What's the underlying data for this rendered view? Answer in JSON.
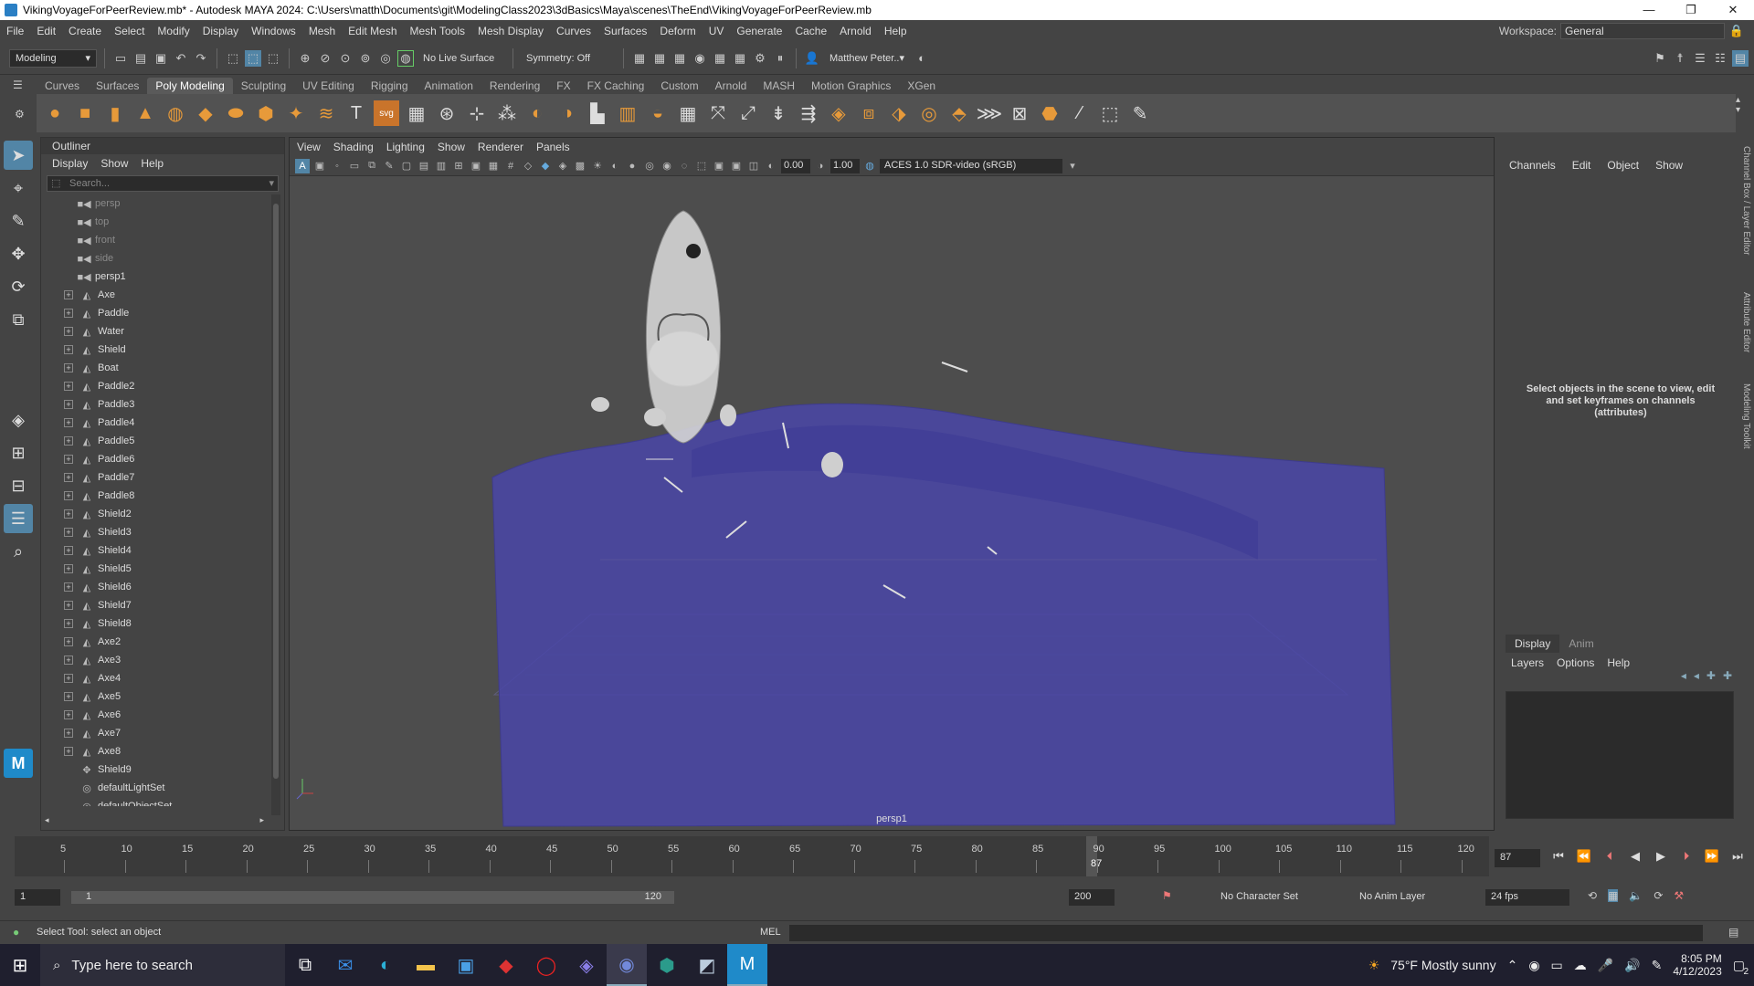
{
  "window": {
    "title": "VikingVoyageForPeerReview.mb* - Autodesk MAYA 2024: C:\\Users\\matth\\Documents\\git\\ModelingClass2023\\3dBasics\\Maya\\scenes\\TheEnd\\VikingVoyageForPeerReview.mb",
    "minimize": "—",
    "maximize": "❐",
    "close": "✕"
  },
  "menubar": {
    "items": [
      "File",
      "Edit",
      "Create",
      "Select",
      "Modify",
      "Display",
      "Windows",
      "Mesh",
      "Edit Mesh",
      "Mesh Tools",
      "Mesh Display",
      "Curves",
      "Surfaces",
      "Deform",
      "UV",
      "Generate",
      "Cache",
      "Arnold",
      "Help"
    ],
    "workspace_label": "Workspace:",
    "workspace_value": "General"
  },
  "statusline": {
    "mode": "Modeling",
    "live_surface": "No Live Surface",
    "symmetry": "Symmetry: Off",
    "user": "Matthew Peter.."
  },
  "shelf": {
    "tabs": [
      "Curves",
      "Surfaces",
      "Poly Modeling",
      "Sculpting",
      "UV Editing",
      "Rigging",
      "Animation",
      "Rendering",
      "FX",
      "FX Caching",
      "Custom",
      "Arnold",
      "MASH",
      "Motion Graphics",
      "XGen"
    ],
    "active_tab": "Poly Modeling"
  },
  "outliner": {
    "title": "Outliner",
    "menu": [
      "Display",
      "Show",
      "Help"
    ],
    "search_placeholder": "Search...",
    "items": [
      {
        "label": "persp",
        "type": "camera",
        "dim": true
      },
      {
        "label": "top",
        "type": "camera",
        "dim": true
      },
      {
        "label": "front",
        "type": "camera",
        "dim": true
      },
      {
        "label": "side",
        "type": "camera",
        "dim": true
      },
      {
        "label": "persp1",
        "type": "camera",
        "dim": false
      },
      {
        "label": "Axe",
        "type": "mesh"
      },
      {
        "label": "Paddle",
        "type": "mesh"
      },
      {
        "label": "Water",
        "type": "mesh"
      },
      {
        "label": "Shield",
        "type": "mesh"
      },
      {
        "label": "Boat",
        "type": "mesh"
      },
      {
        "label": "Paddle2",
        "type": "mesh"
      },
      {
        "label": "Paddle3",
        "type": "mesh"
      },
      {
        "label": "Paddle4",
        "type": "mesh"
      },
      {
        "label": "Paddle5",
        "type": "mesh"
      },
      {
        "label": "Paddle6",
        "type": "mesh"
      },
      {
        "label": "Paddle7",
        "type": "mesh"
      },
      {
        "label": "Paddle8",
        "type": "mesh"
      },
      {
        "label": "Shield2",
        "type": "mesh"
      },
      {
        "label": "Shield3",
        "type": "mesh"
      },
      {
        "label": "Shield4",
        "type": "mesh"
      },
      {
        "label": "Shield5",
        "type": "mesh"
      },
      {
        "label": "Shield6",
        "type": "mesh"
      },
      {
        "label": "Shield7",
        "type": "mesh"
      },
      {
        "label": "Shield8",
        "type": "mesh"
      },
      {
        "label": "Axe2",
        "type": "mesh"
      },
      {
        "label": "Axe3",
        "type": "mesh"
      },
      {
        "label": "Axe4",
        "type": "mesh"
      },
      {
        "label": "Axe5",
        "type": "mesh"
      },
      {
        "label": "Axe6",
        "type": "mesh"
      },
      {
        "label": "Axe7",
        "type": "mesh"
      },
      {
        "label": "Axe8",
        "type": "mesh"
      },
      {
        "label": "Shield9",
        "type": "group"
      },
      {
        "label": "defaultLightSet",
        "type": "set"
      },
      {
        "label": "defaultObjectSet",
        "type": "set"
      }
    ]
  },
  "viewport": {
    "menu": [
      "View",
      "Shading",
      "Lighting",
      "Show",
      "Renderer",
      "Panels"
    ],
    "near_value": "0.00",
    "far_value": "1.00",
    "color_space": "ACES 1.0 SDR-video (sRGB)",
    "camera_label": "persp1"
  },
  "channelbox": {
    "menu": [
      "Channels",
      "Edit",
      "Object",
      "Show"
    ],
    "message": "Select objects in the scene to view, edit and set keyframes on channels (attributes)",
    "layer_tabs": [
      "Display",
      "Anim"
    ],
    "layer_menu": [
      "Layers",
      "Options",
      "Help"
    ],
    "side_tabs": [
      "Channel Box / Layer Editor",
      "Attribute Editor",
      "Modeling Toolkit"
    ]
  },
  "timeline": {
    "ticks": [
      "5",
      "10",
      "15",
      "20",
      "25",
      "30",
      "35",
      "40",
      "45",
      "50",
      "55",
      "60",
      "65",
      "70",
      "75",
      "80",
      "85",
      "90",
      "95",
      "100",
      "105",
      "110",
      "115",
      "120"
    ],
    "current_frame": "87",
    "current_frame_field": "87"
  },
  "range": {
    "start": "1",
    "range_start": "1",
    "range_end": "120",
    "end": "200",
    "character_set": "No Character Set",
    "anim_layer": "No Anim Layer",
    "fps": "24 fps"
  },
  "helpline": {
    "text": "Select Tool: select an object",
    "mel_label": "MEL"
  },
  "taskbar": {
    "search_placeholder": "Type here to search",
    "weather": "75°F  Mostly sunny",
    "time": "8:05 PM",
    "date": "4/12/2023",
    "notifications": "2"
  },
  "colors": {
    "water": "#4a46a8",
    "accent": "#5285a6",
    "shelf_icon": "#e79a3a"
  }
}
